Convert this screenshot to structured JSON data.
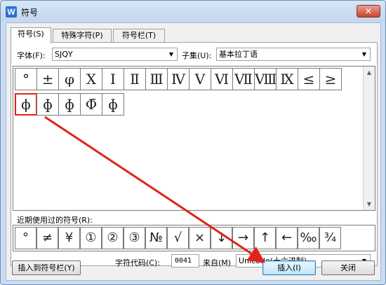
{
  "window": {
    "title": "符号",
    "app_icon": "W",
    "close": "✕"
  },
  "tabs": [
    {
      "label": "符号(S)",
      "active": true
    },
    {
      "label": "特殊字符(P)",
      "active": false
    },
    {
      "label": "符号栏(T)",
      "active": false
    }
  ],
  "font": {
    "label": "字体(F):",
    "value": "SJQY"
  },
  "subset": {
    "label": "子集(U):",
    "value": "基本拉丁语"
  },
  "symbols": {
    "row1": [
      "°",
      "±",
      "φ",
      "Ⅹ",
      "Ⅰ",
      "Ⅱ",
      "Ⅲ",
      "Ⅳ",
      "Ⅴ",
      "Ⅵ",
      "Ⅶ",
      "Ⅷ",
      "Ⅸ",
      "≤",
      "≥"
    ],
    "row2": [
      "ϕ",
      "ɸ",
      "ɸ",
      "Φ̄",
      "ɸ"
    ]
  },
  "recent": {
    "label": "近期使用过的符号(R):",
    "items": [
      "°",
      "≠",
      "¥",
      "①",
      "②",
      "③",
      "№",
      "√",
      "×",
      "↓",
      "→",
      "↑",
      "←",
      "‰",
      "¾"
    ]
  },
  "char_code": {
    "label": "字符代码(C):",
    "value": "0041",
    "from_label": "来自(M)",
    "from_value": "Unicode(十六进制)"
  },
  "buttons": {
    "insert_to_bar": "插入到符号栏(Y)",
    "insert": "插入(I)",
    "close": "关闭"
  },
  "annotation_color": "#e2231a"
}
